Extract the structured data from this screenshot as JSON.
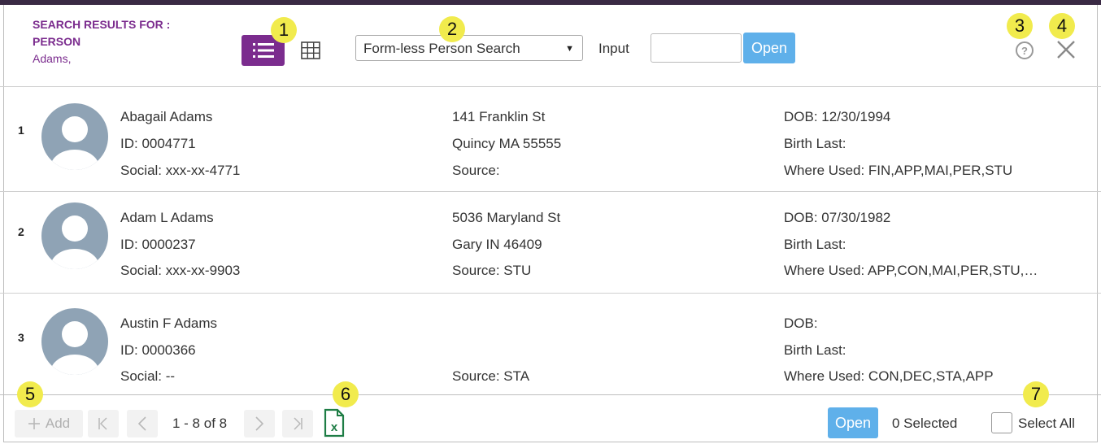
{
  "header": {
    "title_line1": "SEARCH RESULTS FOR :",
    "title_line2": "PERSON",
    "title_line3": "Adams,",
    "list_view_icon": "list-icon",
    "grid_view_icon": "grid-icon",
    "search_type_selected": "Form-less Person Search",
    "input_label": "Input",
    "input_value": "",
    "open_label": "Open",
    "help_icon": "help-icon",
    "close_icon": "close-icon"
  },
  "callouts": [
    "1",
    "2",
    "3",
    "4",
    "5",
    "6",
    "7"
  ],
  "results": [
    {
      "index": "1",
      "name": "Abagail Adams",
      "id": "ID: 0004771",
      "social": "Social: xxx-xx-4771",
      "address1": "141 Franklin St",
      "address2": "Quincy MA 55555",
      "source": "Source:",
      "dob": "DOB: 12/30/1994",
      "birth_last": "Birth Last:",
      "where_used": "Where Used: FIN,APP,MAI,PER,STU"
    },
    {
      "index": "2",
      "name": "Adam L Adams",
      "id": "ID: 0000237",
      "social": "Social: xxx-xx-9903",
      "address1": "5036 Maryland St",
      "address2": "Gary IN 46409",
      "source": "Source: STU",
      "dob": "DOB: 07/30/1982",
      "birth_last": "Birth Last:",
      "where_used": "Where Used: APP,CON,MAI,PER,STU,…"
    },
    {
      "index": "3",
      "name": "Austin F Adams",
      "id": "ID: 0000366",
      "social": "Social: --",
      "address1": "",
      "address2": "",
      "source": "Source: STA",
      "dob": "DOB:",
      "birth_last": "Birth Last:",
      "where_used": "Where Used: CON,DEC,STA,APP"
    }
  ],
  "footer": {
    "add_label": "Add",
    "range_text": "1 - 8 of 8",
    "excel_icon": "excel-icon",
    "open_label": "Open",
    "selected_text": "0 Selected",
    "select_all_label": "Select All",
    "select_all_checked": false
  },
  "colors": {
    "brand_purple": "#7b2c8e",
    "open_blue": "#5fb0ea",
    "callout_yellow": "#f1eb4d",
    "excel_green": "#1e7d45",
    "avatar_gray": "#8fa3b5"
  }
}
